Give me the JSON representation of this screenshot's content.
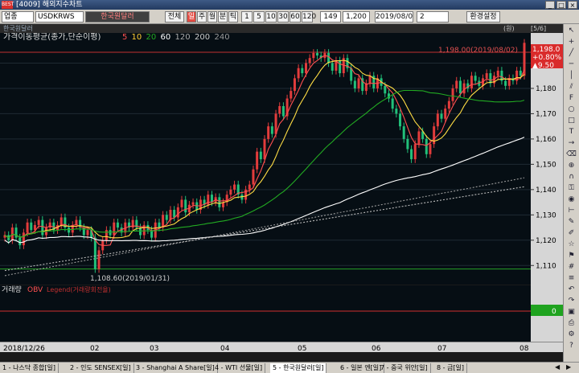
{
  "window": {
    "title": "[4009] 해외지수차트",
    "logo": "BEST"
  },
  "toolbar": {
    "mode_label": "업종",
    "symbol": "USDKRWS",
    "symbol_name": "한국원달러",
    "view_label": "전체",
    "period_buttons": [
      "일",
      "주",
      "월",
      "분",
      "틱"
    ],
    "interval_buttons": [
      "1",
      "5",
      "10",
      "30",
      "60",
      "120"
    ],
    "count": "149",
    "amount": "1,200",
    "date": "2019/08/0",
    "repeat": "2",
    "settings_label": "환경설정"
  },
  "chart": {
    "header_name": "한국원달러",
    "header_page": "[5/6]",
    "header_unit": "(원)",
    "indicator_label": "가격이동평균(종가,단순이평)",
    "ma_periods": [
      "5",
      "10",
      "20",
      "60",
      "120",
      "200",
      "240"
    ],
    "ma_colors": [
      "#ff5050",
      "#ffcc33",
      "#22aa22",
      "#ffffff",
      "#aaaaaa",
      "#cccccc",
      "#999999"
    ],
    "high_label": "1,198.00(2019/08/02)",
    "low_label": "1,108.60(2019/01/31)",
    "last_price": "1,198.0",
    "change_pct": "+0.80%",
    "change_abs": "▲9.50",
    "y_ticks": [
      "1,190",
      "1,180",
      "1,170",
      "1,160",
      "1,150",
      "1,140",
      "1,130",
      "1,120",
      "1,110"
    ],
    "x_ticks": [
      "2018/12/26",
      "02",
      "03",
      "04",
      "05",
      "06",
      "07",
      "08"
    ],
    "volume_label": "거래량",
    "obv_label": "OBV",
    "obv_legend": "Legend(거래량회전율)",
    "obv_value": "0"
  },
  "bottom_tabs": [
    "1 - 나스닥 종합[일]",
    "2 - 인도 SENSEX[일]",
    "3 - Shanghai A Share[일]",
    "4 - WTI 선물[일]",
    "5 - 한국원달러[일]",
    "6 - 일본 엔[일]",
    "7 - 중국 위안[일]",
    "8 - 금[일]"
  ],
  "colors": {
    "up": "#e23c3c",
    "down": "#22c07a",
    "ma5": "#ff5050",
    "ma10": "#ffdd44",
    "ma20": "#22aa22",
    "ma60": "#ffffff"
  },
  "chart_data": {
    "type": "candlestick",
    "y_range": [
      1105,
      1200
    ],
    "closes": [
      1122,
      1120,
      1125,
      1121,
      1118,
      1123,
      1127,
      1124,
      1126,
      1128,
      1122,
      1125,
      1127,
      1124,
      1126,
      1129,
      1125,
      1123,
      1126,
      1128,
      1125,
      1122,
      1124,
      1121,
      1108.6,
      1116,
      1120,
      1124,
      1122,
      1127,
      1125,
      1123,
      1127,
      1125,
      1128,
      1125,
      1122,
      1126,
      1124,
      1121,
      1127,
      1125,
      1130,
      1128,
      1132,
      1129,
      1133,
      1136,
      1131,
      1134,
      1135,
      1132,
      1136,
      1134,
      1138,
      1135,
      1137,
      1133,
      1135,
      1138,
      1140,
      1142,
      1138,
      1136,
      1140,
      1142,
      1148,
      1155,
      1152,
      1160,
      1165,
      1162,
      1170,
      1173,
      1169,
      1176,
      1179,
      1184,
      1188,
      1186,
      1190,
      1192,
      1194,
      1193,
      1192,
      1194,
      1190,
      1187,
      1191,
      1186,
      1192,
      1188,
      1183,
      1180,
      1184,
      1179,
      1182,
      1185,
      1180,
      1184,
      1181,
      1178,
      1176,
      1172,
      1170,
      1165,
      1160,
      1156,
      1152,
      1158,
      1163,
      1160,
      1154,
      1158,
      1165,
      1170,
      1168,
      1172,
      1175,
      1180,
      1183,
      1178,
      1182,
      1180,
      1185,
      1183,
      1181,
      1184,
      1186,
      1182,
      1185,
      1187,
      1183,
      1181,
      1184,
      1183,
      1187,
      1185,
      1198
    ]
  }
}
